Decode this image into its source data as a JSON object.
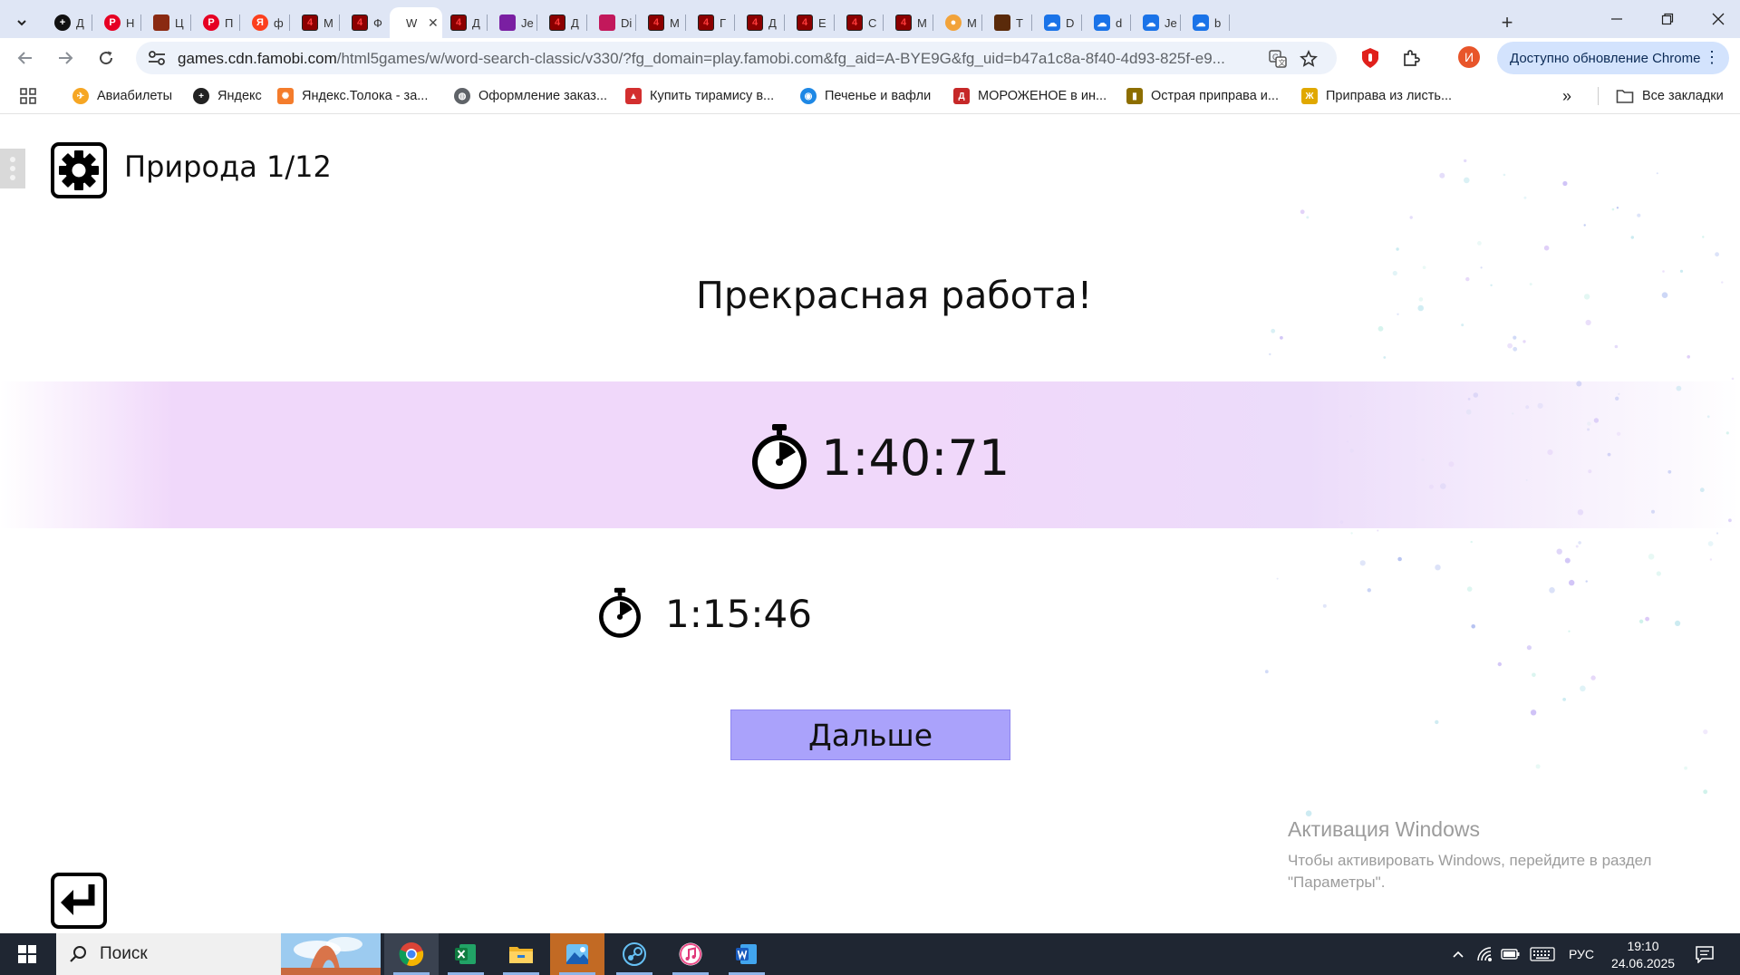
{
  "browser": {
    "tabs": [
      {
        "icon": "yandex-plus-icon",
        "title": "Д",
        "color": "#111111"
      },
      {
        "icon": "pinterest-icon",
        "title": "Н",
        "color": "#e60023"
      },
      {
        "icon": "game-thumb-icon",
        "title": "Ц",
        "color": "#8a2a12"
      },
      {
        "icon": "pinterest-icon",
        "title": "П",
        "color": "#e60023"
      },
      {
        "icon": "yandex-icon",
        "title": "ф",
        "color": "#fc3f1d"
      },
      {
        "icon": "game-4-icon",
        "title": "М",
        "color": "#8b0000"
      },
      {
        "icon": "game-4-icon",
        "title": "Ф",
        "color": "#8b0000"
      },
      {
        "icon": "word-search-icon",
        "title": "W",
        "color": "#ffffff",
        "active": true
      },
      {
        "icon": "game-4-icon",
        "title": "Д",
        "color": "#8b0000"
      },
      {
        "icon": "grid-game-icon",
        "title": "Je",
        "color": "#7a1fa2"
      },
      {
        "icon": "game-4-icon",
        "title": "Д",
        "color": "#8b0000"
      },
      {
        "icon": "ball-game-icon",
        "title": "Di",
        "color": "#c2185b"
      },
      {
        "icon": "game-4-icon",
        "title": "М",
        "color": "#8b0000"
      },
      {
        "icon": "game-4-icon",
        "title": "Г",
        "color": "#8b0000"
      },
      {
        "icon": "game-4-icon",
        "title": "Д",
        "color": "#8b0000"
      },
      {
        "icon": "game-4-icon",
        "title": "Е",
        "color": "#8b0000"
      },
      {
        "icon": "game-4-icon",
        "title": "С",
        "color": "#8b0000"
      },
      {
        "icon": "game-4-icon",
        "title": "М",
        "color": "#8b0000"
      },
      {
        "icon": "food-icon",
        "title": "М",
        "color": "#f2a33a"
      },
      {
        "icon": "game-thumb-icon",
        "title": "Т",
        "color": "#5a2a0a"
      },
      {
        "icon": "cloud-doc-icon",
        "title": "D",
        "color": "#1a73e8"
      },
      {
        "icon": "cloud-doc-icon",
        "title": "d",
        "color": "#1a73e8"
      },
      {
        "icon": "cloud-doc-icon",
        "title": "Je",
        "color": "#1a73e8"
      },
      {
        "icon": "cloud-doc-icon",
        "title": "b",
        "color": "#1a73e8"
      }
    ],
    "url_host": "games.cdn.famobi.com",
    "url_path": "/html5games/w/word-search-classic/v330/?fg_domain=play.famobi.com&fg_aid=A-BYE9G&fg_uid=b47a1c8a-8f40-4d93-825f-e9...",
    "update_label": "Доступно обновление Chrome",
    "profile_initial": "И",
    "bookmarks": [
      {
        "label": "Авиабилеты",
        "icon": "aviatickets-icon",
        "color": "#f6a623"
      },
      {
        "label": "Яндекс",
        "icon": "yandex-plus-icon",
        "color": "#222222"
      },
      {
        "label": "Яндекс.Толока - за...",
        "icon": "toloka-icon",
        "color": "#f47c2c"
      },
      {
        "label": "Оформление заказ...",
        "icon": "globe-icon",
        "color": "#5f6368"
      },
      {
        "label": "Купить тирамису в...",
        "icon": "cake-icon",
        "color": "#d32f2f"
      },
      {
        "label": "Печенье и вафли",
        "icon": "cookie-icon",
        "color": "#1e88e5"
      },
      {
        "label": "МОРОЖЕНОЕ в ин...",
        "icon": "store-d-icon",
        "color": "#c62828"
      },
      {
        "label": "Острая приправа и...",
        "icon": "spice-icon",
        "color": "#8d6e00"
      },
      {
        "label": "Приправа из листь...",
        "icon": "herb-icon",
        "color": "#e0a800"
      }
    ],
    "bookmarks_more": "»",
    "all_bookmarks": "Все закладки"
  },
  "game": {
    "level_title": "Природа 1/12",
    "headline": "Прекрасная работа!",
    "current_time": "1:40:71",
    "best_time": "1:15:46",
    "next_label": "Дальше"
  },
  "watermark": {
    "title": "Активация Windows",
    "text": "Чтобы активировать Windows, перейдите в раздел \"Параметры\"."
  },
  "taskbar": {
    "search_label": "Поиск",
    "apps": [
      "chrome-icon",
      "excel-icon",
      "file-explorer-icon",
      "photos-icon",
      "steam-icon",
      "itunes-icon",
      "word-icon"
    ],
    "lang": "РУС",
    "time": "19:10",
    "date": "24.06.2025"
  },
  "colors": {
    "band": "#f0d8fa",
    "next_button": "#aaa2fb",
    "tabstrip": "#dfe6f5",
    "taskbar": "#1f2632"
  }
}
